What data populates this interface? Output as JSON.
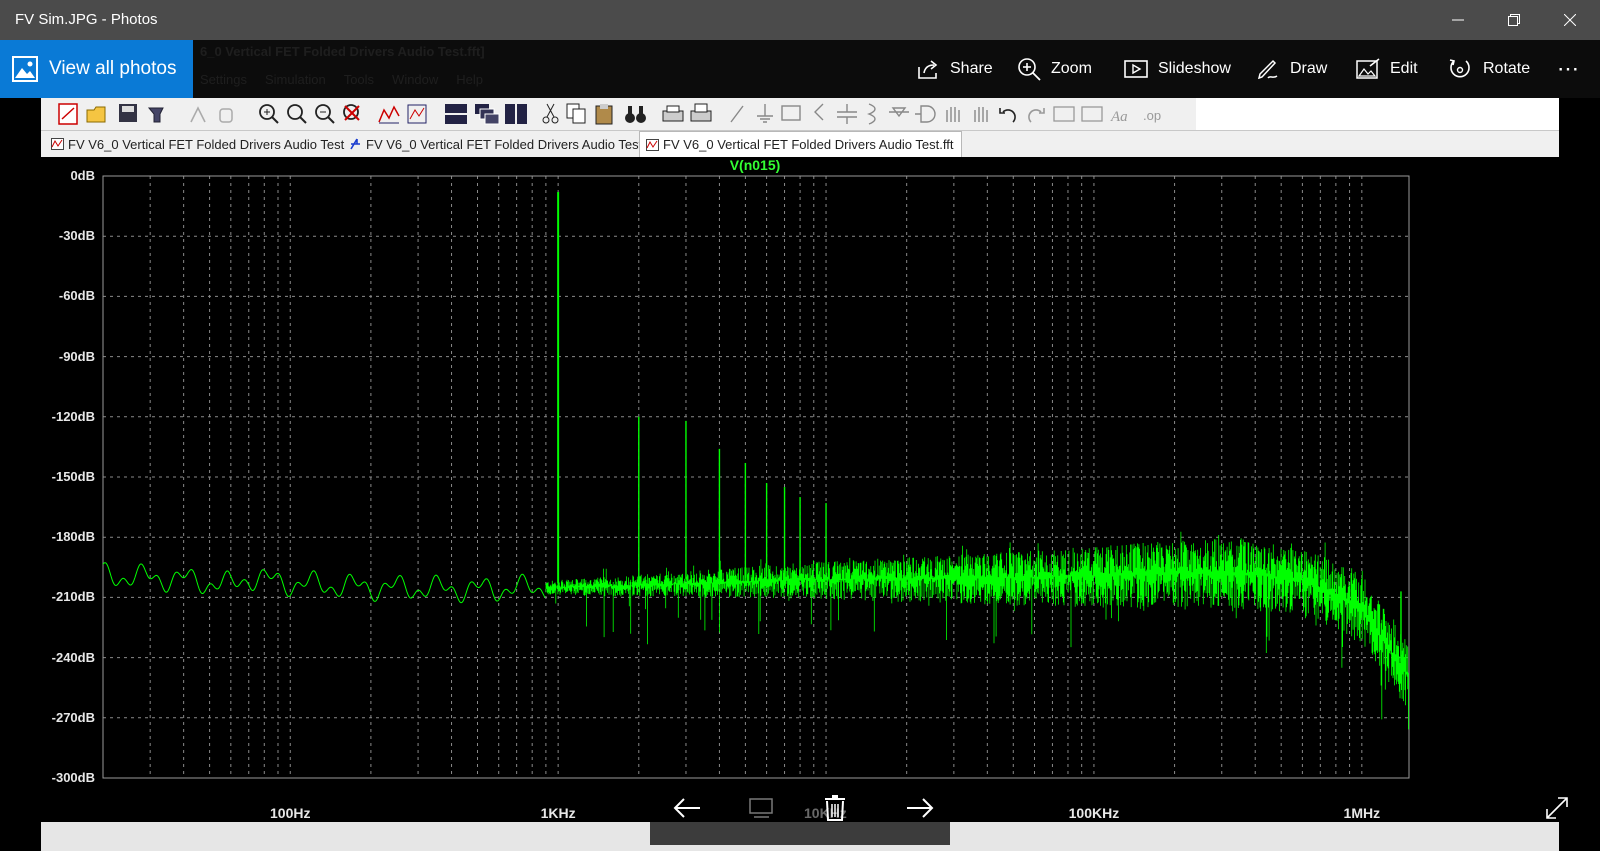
{
  "window": {
    "title": "FV Sim.JPG - Photos"
  },
  "photos_bar": {
    "view_all": "View all photos",
    "commands": [
      {
        "label": "Share",
        "icon": "share-icon"
      },
      {
        "label": "Zoom",
        "icon": "zoom-icon"
      },
      {
        "label": "Slideshow",
        "icon": "slideshow-icon"
      },
      {
        "label": "Draw",
        "icon": "draw-icon"
      },
      {
        "label": "Edit",
        "icon": "edit-icon"
      },
      {
        "label": "Rotate",
        "icon": "rotate-icon"
      }
    ],
    "more": "⋯"
  },
  "ltspice": {
    "hidden_title": "6_0 Vertical FET Folded Drivers Audio Test.fft]",
    "hidden_menu": [
      "Settings",
      "Simulation",
      "Tools",
      "Window",
      "Help"
    ],
    "tabs": [
      {
        "label": "FV V6_0 Vertical FET Folded Drivers Audio Test",
        "icon": "waveform-icon"
      },
      {
        "label": "FV V6_0 Vertical FET Folded Drivers Audio Test",
        "icon": "schematic-icon"
      },
      {
        "label": "FV V6_0 Vertical FET Folded Drivers Audio Test.fft",
        "icon": "waveform-icon"
      }
    ]
  },
  "chart_data": {
    "type": "line",
    "title": "V(n015)",
    "xscale": "log",
    "xlim": [
      20,
      1500000
    ],
    "ylim": [
      -300,
      0
    ],
    "yticks": [
      "0dB",
      "-30dB",
      "-60dB",
      "-90dB",
      "-120dB",
      "-150dB",
      "-180dB",
      "-210dB",
      "-240dB",
      "-270dB",
      "-300dB"
    ],
    "xticks": [
      "100Hz",
      "1KHz",
      "10KHz",
      "100KHz",
      "1MHz"
    ],
    "grid": true,
    "series_color": "#00ff00",
    "series": [
      {
        "name": "V(n015)",
        "noise_floor": [
          [
            20,
            -199
          ],
          [
            40,
            -201
          ],
          [
            60,
            -204
          ],
          [
            70,
            -200
          ],
          [
            100,
            -203
          ],
          [
            200,
            -205
          ],
          [
            500,
            -206
          ],
          [
            1000,
            -205
          ],
          [
            2000,
            -204
          ],
          [
            5000,
            -202
          ],
          [
            10000,
            -201
          ],
          [
            50000,
            -200
          ],
          [
            100000,
            -199
          ],
          [
            300000,
            -197
          ],
          [
            600000,
            -201
          ],
          [
            1000000,
            -215
          ],
          [
            1500000,
            -250
          ]
        ],
        "spikes": [
          [
            1000,
            -8
          ],
          [
            2000,
            -120
          ],
          [
            3000,
            -122
          ],
          [
            4000,
            -136
          ],
          [
            5000,
            -143
          ],
          [
            6000,
            -153
          ],
          [
            7000,
            -155
          ],
          [
            8000,
            -160
          ],
          [
            10000,
            -163
          ],
          [
            1400000,
            -207
          ]
        ]
      }
    ]
  },
  "viewer_nav": {
    "prev": "←",
    "next": "→",
    "overlay_text": "10KHz"
  },
  "colors": {
    "accent": "#0a7ad6",
    "trace": "#00ff00",
    "title_trace": "#33ff33"
  }
}
